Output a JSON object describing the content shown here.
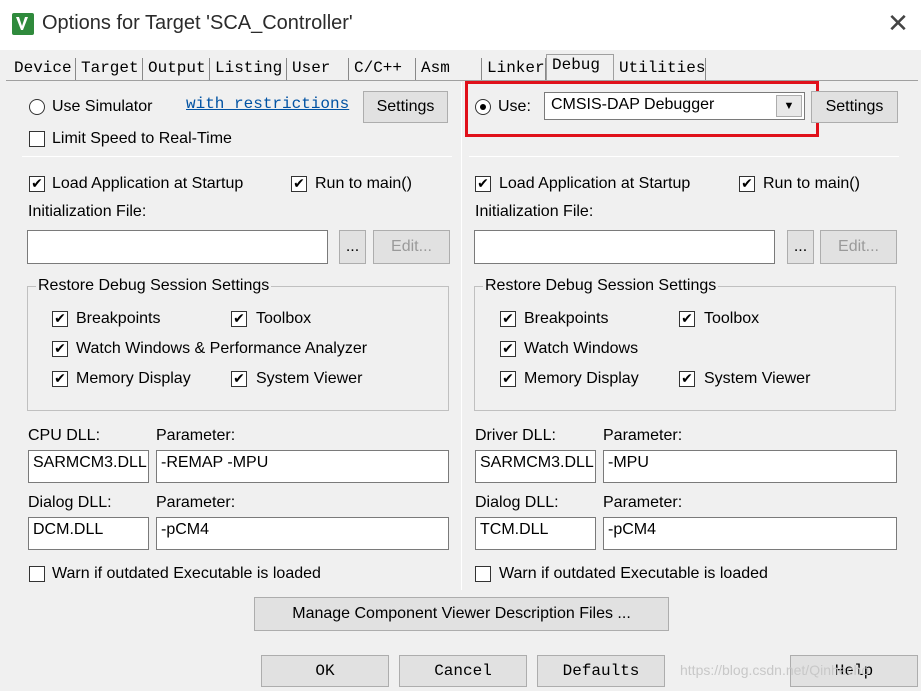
{
  "window": {
    "title": "Options for Target 'SCA_Controller'",
    "close_glyph": "✕",
    "icon": "keil-uvision-icon"
  },
  "tabs": [
    {
      "label": "Device"
    },
    {
      "label": "Target"
    },
    {
      "label": "Output"
    },
    {
      "label": "Listing"
    },
    {
      "label": "User"
    },
    {
      "label": "C/C++"
    },
    {
      "label": "Asm"
    },
    {
      "label": "Linker"
    },
    {
      "label": "Debug",
      "active": true
    },
    {
      "label": "Utilities"
    }
  ],
  "left": {
    "use_simulator_label": "Use Simulator",
    "use_simulator_checked": false,
    "restrictions_link": "with restrictions",
    "settings_label": "Settings",
    "limit_speed_label": "Limit Speed to Real-Time",
    "limit_speed_checked": false,
    "load_app_label": "Load Application at Startup",
    "load_app_checked": true,
    "run_to_main_label": "Run to main()",
    "run_to_main_checked": true,
    "init_file_label": "Initialization File:",
    "init_file_value": "",
    "browse_label": "...",
    "edit_label": "Edit...",
    "restore_group_title": "Restore Debug Session Settings",
    "restore_items": [
      {
        "label": "Breakpoints",
        "checked": true
      },
      {
        "label": "Toolbox",
        "checked": true
      },
      {
        "label": "Watch Windows & Performance Analyzer",
        "checked": true
      },
      {
        "label": "Memory Display",
        "checked": true
      },
      {
        "label": "System Viewer",
        "checked": true
      }
    ],
    "cpu_dll_label": "CPU DLL:",
    "cpu_dll_value": "SARMCM3.DLL",
    "cpu_param_label": "Parameter:",
    "cpu_param_value": "-REMAP -MPU",
    "dialog_dll_label": "Dialog DLL:",
    "dialog_dll_value": "DCM.DLL",
    "dialog_param_label": "Parameter:",
    "dialog_param_value": "-pCM4",
    "warn_label": "Warn if outdated Executable is loaded",
    "warn_checked": false
  },
  "right": {
    "use_label": "Use:",
    "use_checked": true,
    "debugger_value": "CMSIS-DAP Debugger",
    "settings_label": "Settings",
    "load_app_label": "Load Application at Startup",
    "load_app_checked": true,
    "run_to_main_label": "Run to main()",
    "run_to_main_checked": true,
    "init_file_label": "Initialization File:",
    "init_file_value": "",
    "browse_label": "...",
    "edit_label": "Edit...",
    "restore_group_title": "Restore Debug Session Settings",
    "restore_items": [
      {
        "label": "Breakpoints",
        "checked": true
      },
      {
        "label": "Toolbox",
        "checked": true
      },
      {
        "label": "Watch Windows",
        "checked": true
      },
      {
        "label": "Memory Display",
        "checked": true
      },
      {
        "label": "System Viewer",
        "checked": true
      }
    ],
    "driver_dll_label": "Driver DLL:",
    "driver_dll_value": "SARMCM3.DLL",
    "driver_param_label": "Parameter:",
    "driver_param_value": "-MPU",
    "dialog_dll_label": "Dialog DLL:",
    "dialog_dll_value": "TCM.DLL",
    "dialog_param_label": "Parameter:",
    "dialog_param_value": "-pCM4",
    "warn_label": "Warn if outdated Executable is loaded",
    "warn_checked": false
  },
  "manage_button_label": "Manage Component Viewer Description Files ...",
  "footer": {
    "ok_label": "OK",
    "cancel_label": "Cancel",
    "defaults_label": "Defaults",
    "help_label": "Help"
  },
  "watermark": "https://blog.csdn.net/Qinhecho",
  "colors": {
    "highlight": "#e0101a",
    "link": "#0052a3",
    "dialog_bg": "#f0f0f0"
  }
}
